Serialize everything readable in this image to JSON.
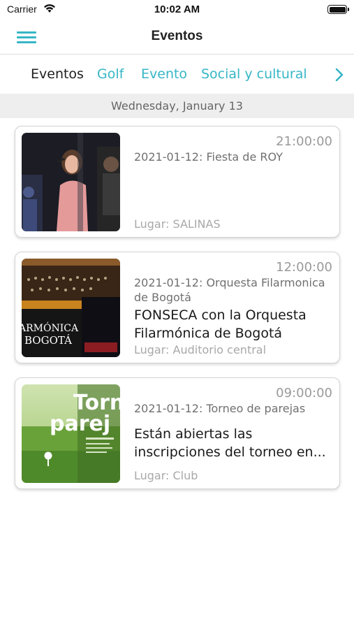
{
  "status_bar": {
    "carrier": "Carrier",
    "time": "10:02 AM"
  },
  "header": {
    "title": "Eventos",
    "menu_icon": "hamburger-menu-icon",
    "accent_color": "#36b6c6"
  },
  "tabs": [
    {
      "label": "Eventos",
      "active": true
    },
    {
      "label": "Golf",
      "active": false
    },
    {
      "label": "Evento",
      "active": false
    },
    {
      "label": "Social y cultural",
      "active": false
    }
  ],
  "tabs_next_icon": "chevron-right-icon",
  "date_header": "Wednesday, January 13",
  "events": [
    {
      "time": "21:00:00",
      "subtitle": "2021-01-12: Fiesta de ROY",
      "title": "",
      "place": "Lugar: SALINAS",
      "image": "singer-photo"
    },
    {
      "time": "12:00:00",
      "subtitle": "2021-01-12: Orquesta Filarmonica de Bogotá",
      "title": "FONSECA con la Orquesta Filarmónica de Bogotá",
      "title_line1": "FONSECA con la Orquesta",
      "title_line2": "Filarmónica de Bogotá",
      "place": "Lugar: Auditorio central",
      "image": "orchestra-poster",
      "image_text_1": "ARMÓNICA",
      "image_text_2": "BOGOTÁ"
    },
    {
      "time": "09:00:00",
      "subtitle": "2021-01-12: Torneo de parejas",
      "title": "Están abiertas las inscripciones del torneo en...",
      "title_line1": "Están abiertas las",
      "title_line2": "inscripciones del torneo en...",
      "place": "Lugar: Club",
      "image": "golf-tournament-poster",
      "image_text_1": "Torn",
      "image_text_2": "parej"
    }
  ]
}
